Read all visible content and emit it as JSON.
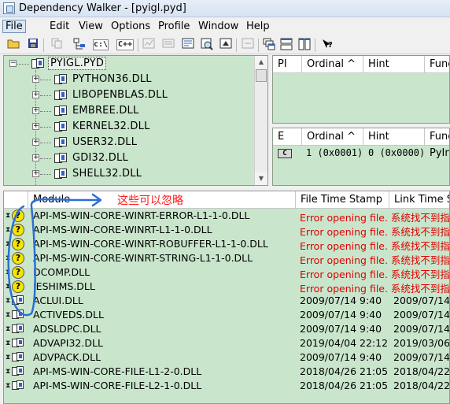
{
  "window": {
    "title": "Dependency Walker - [pyigl.pyd]"
  },
  "menu": [
    {
      "label": "File"
    },
    {
      "label": "Edit"
    },
    {
      "label": "View"
    },
    {
      "label": "Options"
    },
    {
      "label": "Profile"
    },
    {
      "label": "Window"
    },
    {
      "label": "Help"
    }
  ],
  "toolbar": {
    "c_label": "c:\\",
    "cpp_label": "C++"
  },
  "tree": {
    "root": "PYIGL.PYD",
    "children": [
      "PYTHON36.DLL",
      "LIBOPENBLAS.DLL",
      "EMBREE.DLL",
      "KERNEL32.DLL",
      "USER32.DLL",
      "GDI32.DLL",
      "SHELL32.DLL"
    ]
  },
  "pi_table": {
    "headers": [
      "PI",
      "Ordinal ^",
      "Hint",
      "Function"
    ]
  },
  "e_table": {
    "headers": [
      "E",
      "Ordinal ^",
      "Hint",
      "Function"
    ],
    "rows": [
      {
        "icon": "C",
        "ordinal": "1 (0x0001)",
        "hint": "0 (0x0000)",
        "function": "PyInit"
      }
    ]
  },
  "module_table": {
    "headers": [
      "Module",
      "File Time Stamp",
      "Link Time Stamp"
    ],
    "rows": [
      {
        "name": "API-MS-WIN-CORE-WINRT-ERROR-L1-1-0.DLL",
        "file_ts": "Error opening file. 系统找不到指定",
        "link_ts": "",
        "status": "missing"
      },
      {
        "name": "API-MS-WIN-CORE-WINRT-L1-1-0.DLL",
        "file_ts": "Error opening file. 系统找不到指定",
        "link_ts": "",
        "status": "missing"
      },
      {
        "name": "API-MS-WIN-CORE-WINRT-ROBUFFER-L1-1-0.DLL",
        "file_ts": "Error opening file. 系统找不到指定",
        "link_ts": "",
        "status": "missing"
      },
      {
        "name": "API-MS-WIN-CORE-WINRT-STRING-L1-1-0.DLL",
        "file_ts": "Error opening file. 系统找不到指定",
        "link_ts": "",
        "status": "missing"
      },
      {
        "name": "DCOMP.DLL",
        "file_ts": "Error opening file. 系统找不到指定",
        "link_ts": "",
        "status": "missing"
      },
      {
        "name": "IESHIMS.DLL",
        "file_ts": "Error opening file. 系统找不到指定",
        "link_ts": "",
        "status": "missing"
      },
      {
        "name": "ACLUI.DLL",
        "file_ts": "2009/07/14   9:40",
        "link_ts": "2009/07/14",
        "status": "ok"
      },
      {
        "name": "ACTIVEDS.DLL",
        "file_ts": "2009/07/14   9:40",
        "link_ts": "2009/07/14",
        "status": "ok"
      },
      {
        "name": "ADSLDPC.DLL",
        "file_ts": "2009/07/14   9:40",
        "link_ts": "2009/07/14",
        "status": "ok"
      },
      {
        "name": "ADVAPI32.DLL",
        "file_ts": "2019/04/04 22:12",
        "link_ts": "2019/03/06",
        "status": "ok"
      },
      {
        "name": "ADVPACK.DLL",
        "file_ts": "2009/07/14   9:40",
        "link_ts": "2009/07/14",
        "status": "ok"
      },
      {
        "name": "API-MS-WIN-CORE-FILE-L1-2-0.DLL",
        "file_ts": "2018/04/26 21:05",
        "link_ts": "2018/04/22",
        "status": "ok"
      },
      {
        "name": "API-MS-WIN-CORE-FILE-L2-1-0.DLL",
        "file_ts": "2018/04/26 21:05",
        "link_ts": "2018/04/22",
        "status": "ok"
      }
    ]
  },
  "annotation": {
    "text": "这些可以忽略"
  },
  "colors": {
    "panel_bg": "#c9e6cc",
    "error_text": "#e00000",
    "annotation": "#ff1a1a",
    "outline": "#2d6fd6"
  }
}
